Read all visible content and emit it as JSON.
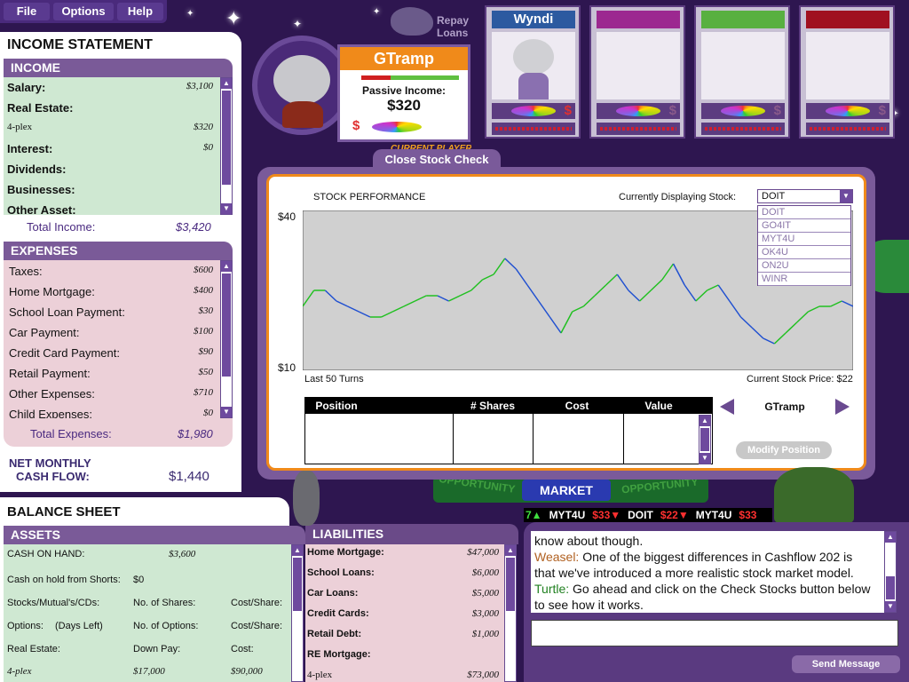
{
  "menu": {
    "items": [
      "File",
      "Options",
      "Help"
    ]
  },
  "repay": {
    "line1": "Repay",
    "line2": "Loans"
  },
  "current_player": {
    "name": "GTramp",
    "passive_label": "Passive Income:",
    "passive_value": "$320",
    "current_label": "CURRENT PLAYER",
    "dollar": "$"
  },
  "players": [
    {
      "name": "Wyndi",
      "color": "#2c5aa0"
    },
    {
      "name": "",
      "color": "#9c2890"
    },
    {
      "name": "",
      "color": "#58b040"
    },
    {
      "name": "",
      "color": "#a01020"
    }
  ],
  "income_statement": {
    "title": "INCOME STATEMENT",
    "income_header": "INCOME",
    "income_rows": [
      {
        "label": "Salary:",
        "value": "$3,100"
      },
      {
        "label": "Real Estate:",
        "value": ""
      },
      {
        "label": "4-plex",
        "value": "$320"
      },
      {
        "label": "Interest:",
        "value": "$0"
      },
      {
        "label": "Dividends:",
        "value": ""
      },
      {
        "label": "Businesses:",
        "value": ""
      },
      {
        "label": "Other Asset:",
        "value": ""
      }
    ],
    "total_income_label": "Total Income:",
    "total_income_value": "$3,420",
    "expenses_header": "EXPENSES",
    "expense_rows": [
      {
        "label": "Taxes:",
        "value": "$600"
      },
      {
        "label": "Home Mortgage:",
        "value": "$400"
      },
      {
        "label": "School Loan Payment:",
        "value": "$30"
      },
      {
        "label": "Car Payment:",
        "value": "$100"
      },
      {
        "label": "Credit Card Payment:",
        "value": "$90"
      },
      {
        "label": "Retail Payment:",
        "value": "$50"
      },
      {
        "label": "Other Expenses:",
        "value": "$710"
      },
      {
        "label": "Child Expenses:",
        "value": "$0"
      }
    ],
    "total_expenses_label": "Total Expenses:",
    "total_expenses_value": "$1,980",
    "net_line1": "NET MONTHLY",
    "net_line2": "CASH FLOW:",
    "net_value": "$1,440"
  },
  "balance_sheet": {
    "title": "BALANCE SHEET",
    "assets_header": "ASSETS",
    "cash_label": "CASH ON HAND:",
    "cash_value": "$3,600",
    "shorts_label": "Cash on hold from Shorts:",
    "shorts_value": "$0",
    "stocks_label": "Stocks/Mutual's/CDs:",
    "stocks_col2": "No. of Shares:",
    "stocks_col3": "Cost/Share:",
    "options_label": "Options:",
    "options_days": "(Days Left)",
    "options_col2": "No. of Options:",
    "options_col3": "Cost/Share:",
    "re_label": "Real Estate:",
    "re_col2": "Down Pay:",
    "re_col3": "Cost:",
    "plex_label": "4-plex",
    "plex_down": "$17,000",
    "plex_cost": "$90,000",
    "liabilities_header": "LIABILITIES",
    "liability_rows": [
      {
        "label": "Home Mortgage:",
        "value": "$47,000"
      },
      {
        "label": "School Loans:",
        "value": "$6,000"
      },
      {
        "label": "Car Loans:",
        "value": "$5,000"
      },
      {
        "label": "Credit Cards:",
        "value": "$3,000"
      },
      {
        "label": "Retail Debt:",
        "value": "$1,000"
      },
      {
        "label": "RE Mortgage:",
        "value": ""
      },
      {
        "label": "4-plex",
        "value": "$73,000"
      }
    ]
  },
  "stock": {
    "tab_label": "Close Stock Check",
    "title": "STOCK PERFORMANCE",
    "displaying_label": "Currently Displaying Stock:",
    "selected": "DOIT",
    "options": [
      "DOIT",
      "GO4IT",
      "MYT4U",
      "OK4U",
      "ON2U",
      "WINR"
    ],
    "last_turns": "Last 50 Turns",
    "current_price": "Current Stock Price: $22",
    "table_headers": [
      "Position",
      "# Shares",
      "Cost",
      "Value"
    ],
    "player_name": "GTramp",
    "modify_label": "Modify Position"
  },
  "chart_data": {
    "type": "line",
    "title": "STOCK PERFORMANCE",
    "xlabel": "Last 50 Turns",
    "ylim": [
      10,
      40
    ],
    "ytick_labels": [
      "$40",
      "$10"
    ],
    "values": [
      22,
      25,
      25,
      23,
      22,
      21,
      20,
      20,
      21,
      22,
      23,
      24,
      24,
      23,
      24,
      25,
      27,
      28,
      31,
      29,
      26,
      23,
      20,
      17,
      21,
      22,
      24,
      26,
      28,
      25,
      23,
      25,
      27,
      30,
      26,
      23,
      25,
      26,
      23,
      20,
      18,
      16,
      15,
      17,
      19,
      21,
      22,
      22,
      23,
      22
    ],
    "colors": [
      "#20c020",
      "#2050d0"
    ]
  },
  "board": {
    "opportunity": "OPPORTUNITY",
    "market": "MARKET",
    "opportunity2": "OPPORTUNITY"
  },
  "ticker": [
    {
      "text": "7▲",
      "color": "#40e040"
    },
    {
      "text": "MYT4U",
      "color": "#ffffff"
    },
    {
      "text": "$33▼",
      "color": "#ff3030"
    },
    {
      "text": "DOIT",
      "color": "#ffffff"
    },
    {
      "text": "$22▼",
      "color": "#ff3030"
    },
    {
      "text": "MYT4U",
      "color": "#ffffff"
    },
    {
      "text": "$33",
      "color": "#ff3030"
    }
  ],
  "chat": {
    "line1": "know about though.",
    "speaker1": "Weasel:",
    "msg1a": "One of the biggest differences in Cashflow 202 is",
    "msg1b": "that we've introduced a more realistic stock market model.",
    "speaker2": "Turtle:",
    "msg2a": "Go ahead and click on the Check Stocks button below",
    "msg2b": "to see how it works.",
    "send_label": "Send Message"
  }
}
